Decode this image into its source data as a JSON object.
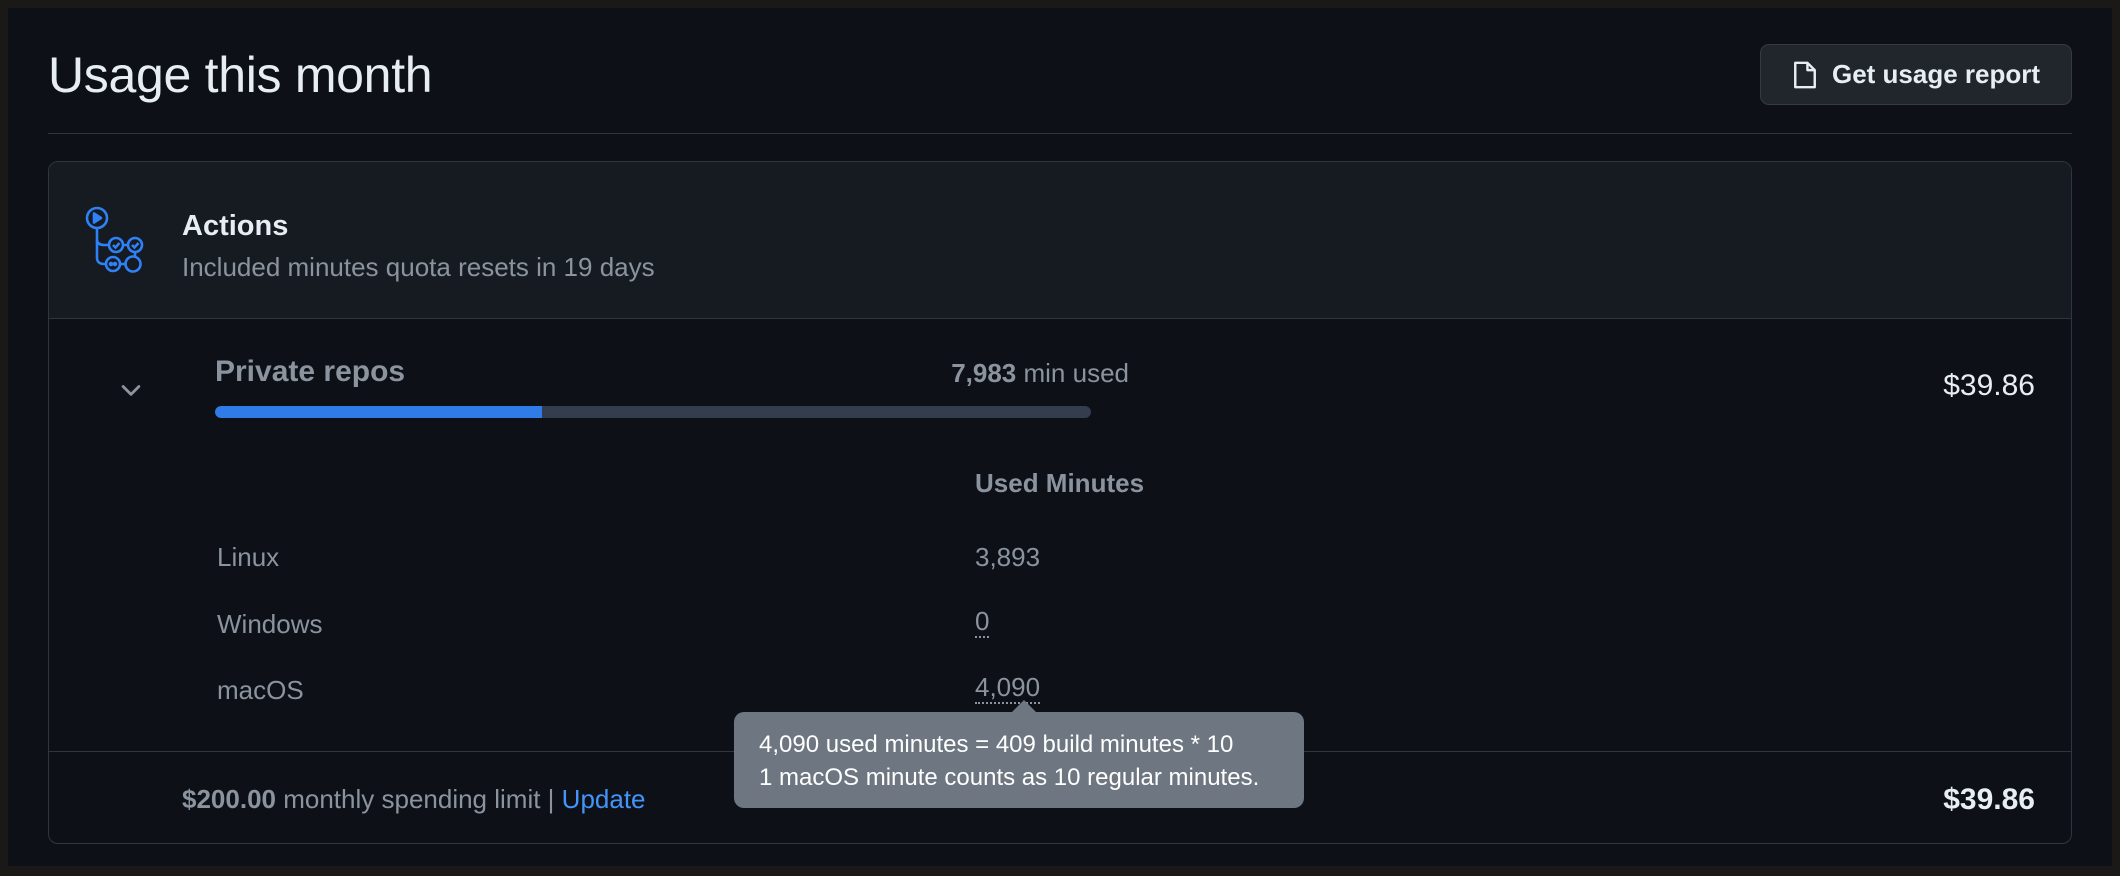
{
  "header": {
    "title": "Usage this month",
    "report_button_label": "Get usage report"
  },
  "actions": {
    "title": "Actions",
    "subtitle": "Included minutes quota resets in 19 days",
    "private_repos": {
      "label": "Private repos",
      "minutes_used": "7,983",
      "minutes_suffix": "min used",
      "usage_fraction": 0.373,
      "cost": "$39.86"
    },
    "table": {
      "column_header": "Used Minutes",
      "rows": [
        {
          "os": "Linux",
          "minutes": "3,893"
        },
        {
          "os": "Windows",
          "minutes": "0"
        },
        {
          "os": "macOS",
          "minutes": "4,090"
        }
      ]
    },
    "footer": {
      "limit_amount": "$200.00",
      "limit_text": "monthly spending limit |",
      "update_link": "Update",
      "total_cost": "$39.86"
    }
  },
  "tooltip": {
    "line1": "4,090 used minutes = 409 build minutes * 10",
    "line2": "1 macOS minute counts as 10 regular minutes."
  },
  "colors": {
    "background": "#0d1117",
    "card_header": "#161b22",
    "accent": "#2f7ce8",
    "link": "#4493f8",
    "tooltip": "#6e7681"
  }
}
